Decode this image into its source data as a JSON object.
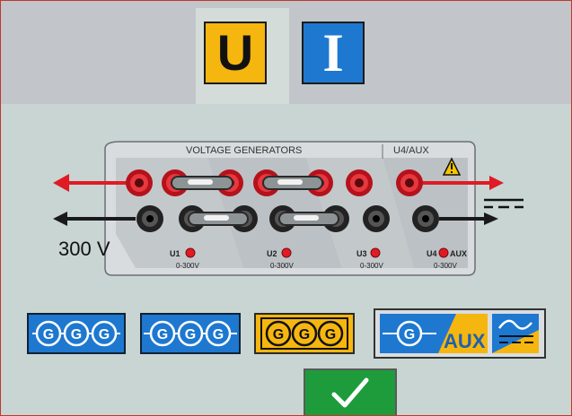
{
  "tabs": {
    "voltage_label": "U",
    "current_label": "I"
  },
  "panel": {
    "title": "VOLTAGE GENERATORS",
    "aux_title": "U4/AUX",
    "voltage_text": "300 V",
    "channels": [
      {
        "name": "U1",
        "range": "0-300V"
      },
      {
        "name": "U2",
        "range": "0-300V"
      },
      {
        "name": "U3",
        "range": "0-300V"
      },
      {
        "name": "U4",
        "aux": "AUX",
        "range": "0-300V"
      }
    ]
  },
  "config_buttons": {
    "generator_letter": "G",
    "aux_label": "AUX"
  },
  "colors": {
    "voltage_tab": "#f5b60f",
    "current_tab": "#1e78d0",
    "red_wire": "#e01b24",
    "confirm": "#1e9c3c"
  },
  "icons": [
    "warning-icon",
    "dc-symbol-icon",
    "ac-dc-icon",
    "checkmark-icon"
  ]
}
